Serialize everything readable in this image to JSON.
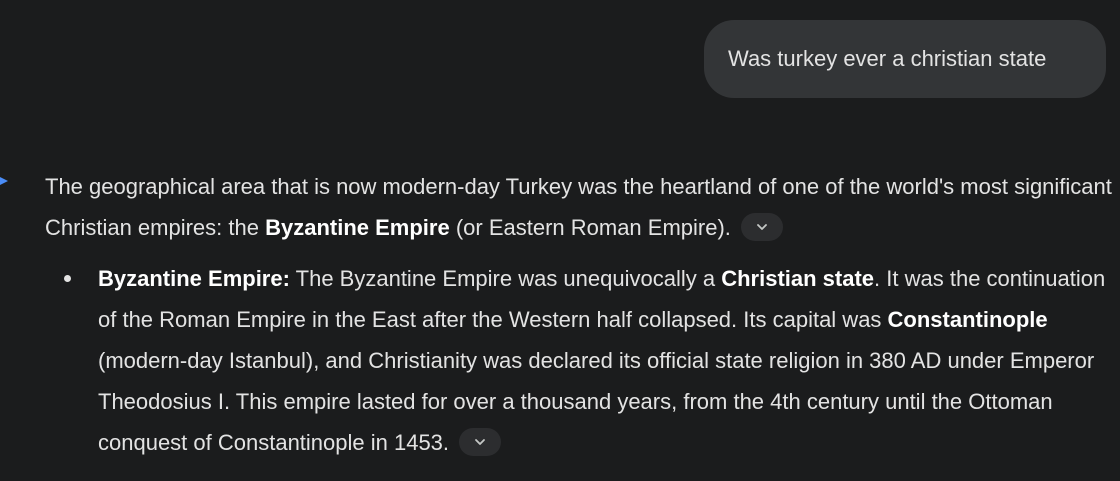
{
  "user_message": {
    "text": "Was turkey ever a christian state"
  },
  "response": {
    "paragraph": {
      "t1": "The geographical area that is now modern-day Turkey was the heartland of one of the world's most significant Christian empires: the ",
      "b1": "Byzantine Empire",
      "t2": " (or Eastern Roman Empire)."
    },
    "bullets": [
      {
        "b1": "Byzantine Empire:",
        "t1": " The Byzantine Empire was unequivocally a ",
        "b2": "Christian state",
        "t2": ". It was the continuation of the Roman Empire in the East after the Western half collapsed. Its capital was ",
        "b3": "Constantinople",
        "t3": " (modern-day Istanbul), and Christianity was declared its official state religion in 380 AD under Emperor Theodosius I. This empire lasted for over a thousand years, from the 4th century until the Ottoman conquest of Constantinople in 1453."
      }
    ]
  },
  "icons": {
    "expand_chip": "chevron-down-icon",
    "response_marker": "gemini-spark-icon"
  },
  "colors": {
    "background": "#1b1c1d",
    "user_bubble": "#333537",
    "text": "#e3e3e3",
    "accent": "#4a8cf7"
  }
}
